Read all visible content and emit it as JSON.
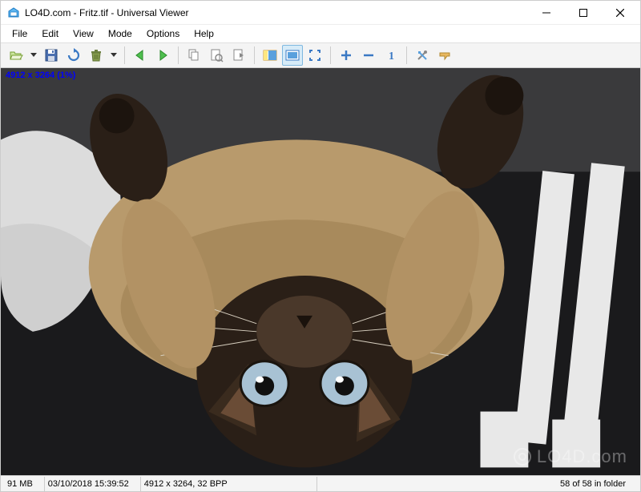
{
  "titlebar": {
    "title": "LO4D.com - Fritz.tif - Universal Viewer"
  },
  "menu": {
    "file": "File",
    "edit": "Edit",
    "view": "View",
    "mode": "Mode",
    "options": "Options",
    "help": "Help"
  },
  "overlay": "4912 x 3264 (1%)",
  "status": {
    "size": "91 MB",
    "datetime": "03/10/2018 15:39:52",
    "dims": "4912 x 3264, 32 BPP",
    "position": "58 of 58 in folder"
  },
  "watermark": "LO4D.com"
}
